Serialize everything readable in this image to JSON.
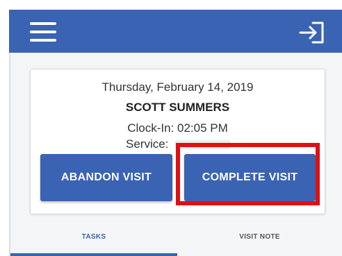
{
  "header": {
    "menu_icon": "hamburger-menu-icon",
    "signout_icon": "sign-out-icon",
    "background_color": "#3a63b3"
  },
  "visit": {
    "date": "Thursday, February 14, 2019",
    "client_name": "SCOTT SUMMERS",
    "clock_in": "Clock-In: 02:05 PM",
    "service_label": "Service:"
  },
  "actions": {
    "abandon_label": "ABANDON VISIT",
    "complete_label": "COMPLETE VISIT",
    "button_color": "#3a63b3"
  },
  "annotation": {
    "highlight_color": "#e01010"
  },
  "tabs": [
    {
      "label": "TASKS",
      "active": true
    },
    {
      "label": "VISIT NOTE",
      "active": false
    }
  ]
}
